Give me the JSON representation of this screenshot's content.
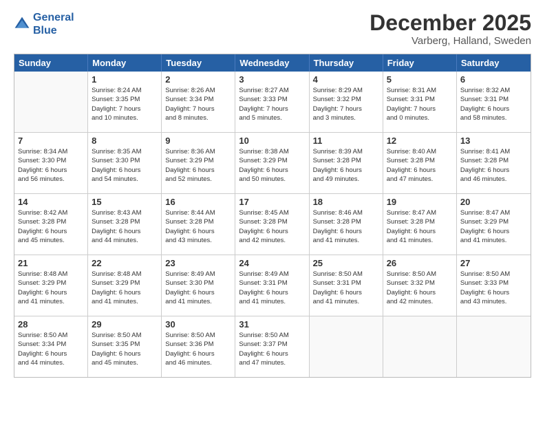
{
  "logo": {
    "line1": "General",
    "line2": "Blue"
  },
  "title": "December 2025",
  "subtitle": "Varberg, Halland, Sweden",
  "days": [
    "Sunday",
    "Monday",
    "Tuesday",
    "Wednesday",
    "Thursday",
    "Friday",
    "Saturday"
  ],
  "weeks": [
    [
      {
        "day": "",
        "content": ""
      },
      {
        "day": "1",
        "content": "Sunrise: 8:24 AM\nSunset: 3:35 PM\nDaylight: 7 hours\nand 10 minutes."
      },
      {
        "day": "2",
        "content": "Sunrise: 8:26 AM\nSunset: 3:34 PM\nDaylight: 7 hours\nand 8 minutes."
      },
      {
        "day": "3",
        "content": "Sunrise: 8:27 AM\nSunset: 3:33 PM\nDaylight: 7 hours\nand 5 minutes."
      },
      {
        "day": "4",
        "content": "Sunrise: 8:29 AM\nSunset: 3:32 PM\nDaylight: 7 hours\nand 3 minutes."
      },
      {
        "day": "5",
        "content": "Sunrise: 8:31 AM\nSunset: 3:31 PM\nDaylight: 7 hours\nand 0 minutes."
      },
      {
        "day": "6",
        "content": "Sunrise: 8:32 AM\nSunset: 3:31 PM\nDaylight: 6 hours\nand 58 minutes."
      }
    ],
    [
      {
        "day": "7",
        "content": "Sunrise: 8:34 AM\nSunset: 3:30 PM\nDaylight: 6 hours\nand 56 minutes."
      },
      {
        "day": "8",
        "content": "Sunrise: 8:35 AM\nSunset: 3:30 PM\nDaylight: 6 hours\nand 54 minutes."
      },
      {
        "day": "9",
        "content": "Sunrise: 8:36 AM\nSunset: 3:29 PM\nDaylight: 6 hours\nand 52 minutes."
      },
      {
        "day": "10",
        "content": "Sunrise: 8:38 AM\nSunset: 3:29 PM\nDaylight: 6 hours\nand 50 minutes."
      },
      {
        "day": "11",
        "content": "Sunrise: 8:39 AM\nSunset: 3:28 PM\nDaylight: 6 hours\nand 49 minutes."
      },
      {
        "day": "12",
        "content": "Sunrise: 8:40 AM\nSunset: 3:28 PM\nDaylight: 6 hours\nand 47 minutes."
      },
      {
        "day": "13",
        "content": "Sunrise: 8:41 AM\nSunset: 3:28 PM\nDaylight: 6 hours\nand 46 minutes."
      }
    ],
    [
      {
        "day": "14",
        "content": "Sunrise: 8:42 AM\nSunset: 3:28 PM\nDaylight: 6 hours\nand 45 minutes."
      },
      {
        "day": "15",
        "content": "Sunrise: 8:43 AM\nSunset: 3:28 PM\nDaylight: 6 hours\nand 44 minutes."
      },
      {
        "day": "16",
        "content": "Sunrise: 8:44 AM\nSunset: 3:28 PM\nDaylight: 6 hours\nand 43 minutes."
      },
      {
        "day": "17",
        "content": "Sunrise: 8:45 AM\nSunset: 3:28 PM\nDaylight: 6 hours\nand 42 minutes."
      },
      {
        "day": "18",
        "content": "Sunrise: 8:46 AM\nSunset: 3:28 PM\nDaylight: 6 hours\nand 41 minutes."
      },
      {
        "day": "19",
        "content": "Sunrise: 8:47 AM\nSunset: 3:28 PM\nDaylight: 6 hours\nand 41 minutes."
      },
      {
        "day": "20",
        "content": "Sunrise: 8:47 AM\nSunset: 3:29 PM\nDaylight: 6 hours\nand 41 minutes."
      }
    ],
    [
      {
        "day": "21",
        "content": "Sunrise: 8:48 AM\nSunset: 3:29 PM\nDaylight: 6 hours\nand 41 minutes."
      },
      {
        "day": "22",
        "content": "Sunrise: 8:48 AM\nSunset: 3:29 PM\nDaylight: 6 hours\nand 41 minutes."
      },
      {
        "day": "23",
        "content": "Sunrise: 8:49 AM\nSunset: 3:30 PM\nDaylight: 6 hours\nand 41 minutes."
      },
      {
        "day": "24",
        "content": "Sunrise: 8:49 AM\nSunset: 3:31 PM\nDaylight: 6 hours\nand 41 minutes."
      },
      {
        "day": "25",
        "content": "Sunrise: 8:50 AM\nSunset: 3:31 PM\nDaylight: 6 hours\nand 41 minutes."
      },
      {
        "day": "26",
        "content": "Sunrise: 8:50 AM\nSunset: 3:32 PM\nDaylight: 6 hours\nand 42 minutes."
      },
      {
        "day": "27",
        "content": "Sunrise: 8:50 AM\nSunset: 3:33 PM\nDaylight: 6 hours\nand 43 minutes."
      }
    ],
    [
      {
        "day": "28",
        "content": "Sunrise: 8:50 AM\nSunset: 3:34 PM\nDaylight: 6 hours\nand 44 minutes."
      },
      {
        "day": "29",
        "content": "Sunrise: 8:50 AM\nSunset: 3:35 PM\nDaylight: 6 hours\nand 45 minutes."
      },
      {
        "day": "30",
        "content": "Sunrise: 8:50 AM\nSunset: 3:36 PM\nDaylight: 6 hours\nand 46 minutes."
      },
      {
        "day": "31",
        "content": "Sunrise: 8:50 AM\nSunset: 3:37 PM\nDaylight: 6 hours\nand 47 minutes."
      },
      {
        "day": "",
        "content": ""
      },
      {
        "day": "",
        "content": ""
      },
      {
        "day": "",
        "content": ""
      }
    ]
  ]
}
